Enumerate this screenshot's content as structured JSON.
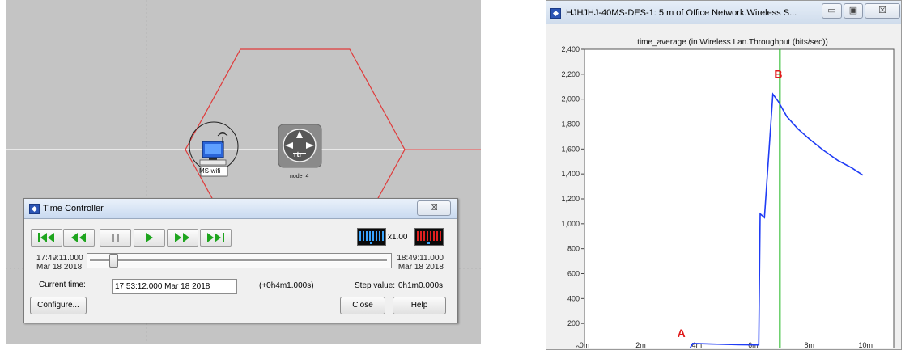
{
  "network": {
    "node_wifi_label": "MS-wifi",
    "node_router_label": "node_4",
    "router_icon_text": "rtr"
  },
  "time_controller": {
    "title": "Time Controller",
    "close_glyph": "☒",
    "speed": "x1.00",
    "start_time": "17:49:11.000",
    "start_date": "Mar 18 2018",
    "end_time": "18:49:11.000",
    "end_date": "Mar 18 2018",
    "slider_position_fraction": 0.067,
    "current_time_label": "Current time:",
    "current_time_value": "17:53:12.000 Mar 18 2018",
    "offset": "(+0h4m1.000s)",
    "step_label": "Step value:",
    "step_value": "0h1m0.000s",
    "configure_label": "Configure...",
    "close_label": "Close",
    "help_label": "Help",
    "colors": {
      "play_green": "#1ea51e",
      "title_blue": "#c9daf0"
    }
  },
  "graph_window": {
    "title": "HJHJHJ-40MS-DES-1: 5 m of Office Network.Wireless S...",
    "btn_minimize": "▭",
    "btn_maximize": "▣",
    "btn_close": "☒",
    "chart_title": "time_average (in Wireless Lan.Throughput (bits/sec))",
    "marker_a": "A",
    "marker_b": "B"
  },
  "chart_data": {
    "type": "line",
    "title": "time_average (in Wireless Lan.Throughput (bits/sec))",
    "x_ticks": [
      "0m",
      "2m",
      "4m",
      "6m",
      "8m",
      "10m"
    ],
    "y_ticks": [
      "0",
      "200",
      "400",
      "600",
      "800",
      "1,000",
      "1,200",
      "1,400",
      "1,600",
      "1,800",
      "2,000",
      "2,200",
      "2,400"
    ],
    "xlim": [
      0,
      11
    ],
    "ylim": [
      0,
      2400
    ],
    "grid": false,
    "series": [
      {
        "color": "#1f3cf5",
        "points": [
          [
            0,
            0
          ],
          [
            3.75,
            0
          ],
          [
            3.85,
            40
          ],
          [
            4.5,
            35
          ],
          [
            5.5,
            30
          ],
          [
            6.2,
            28
          ],
          [
            6.25,
            1080
          ],
          [
            6.4,
            1050
          ],
          [
            6.7,
            2040
          ],
          [
            6.9,
            1980
          ],
          [
            7.2,
            1860
          ],
          [
            7.6,
            1760
          ],
          [
            8.0,
            1680
          ],
          [
            8.5,
            1590
          ],
          [
            9.0,
            1510
          ],
          [
            9.5,
            1450
          ],
          [
            9.9,
            1390
          ]
        ]
      }
    ],
    "marker_line": {
      "x": 6.95,
      "color": "#22b822"
    },
    "annotations": [
      {
        "text": "A",
        "x": 3.3,
        "y": 90,
        "color": "#e01b1b"
      },
      {
        "text": "B",
        "x": 6.75,
        "y": 2170,
        "color": "#e01b1b"
      }
    ]
  }
}
